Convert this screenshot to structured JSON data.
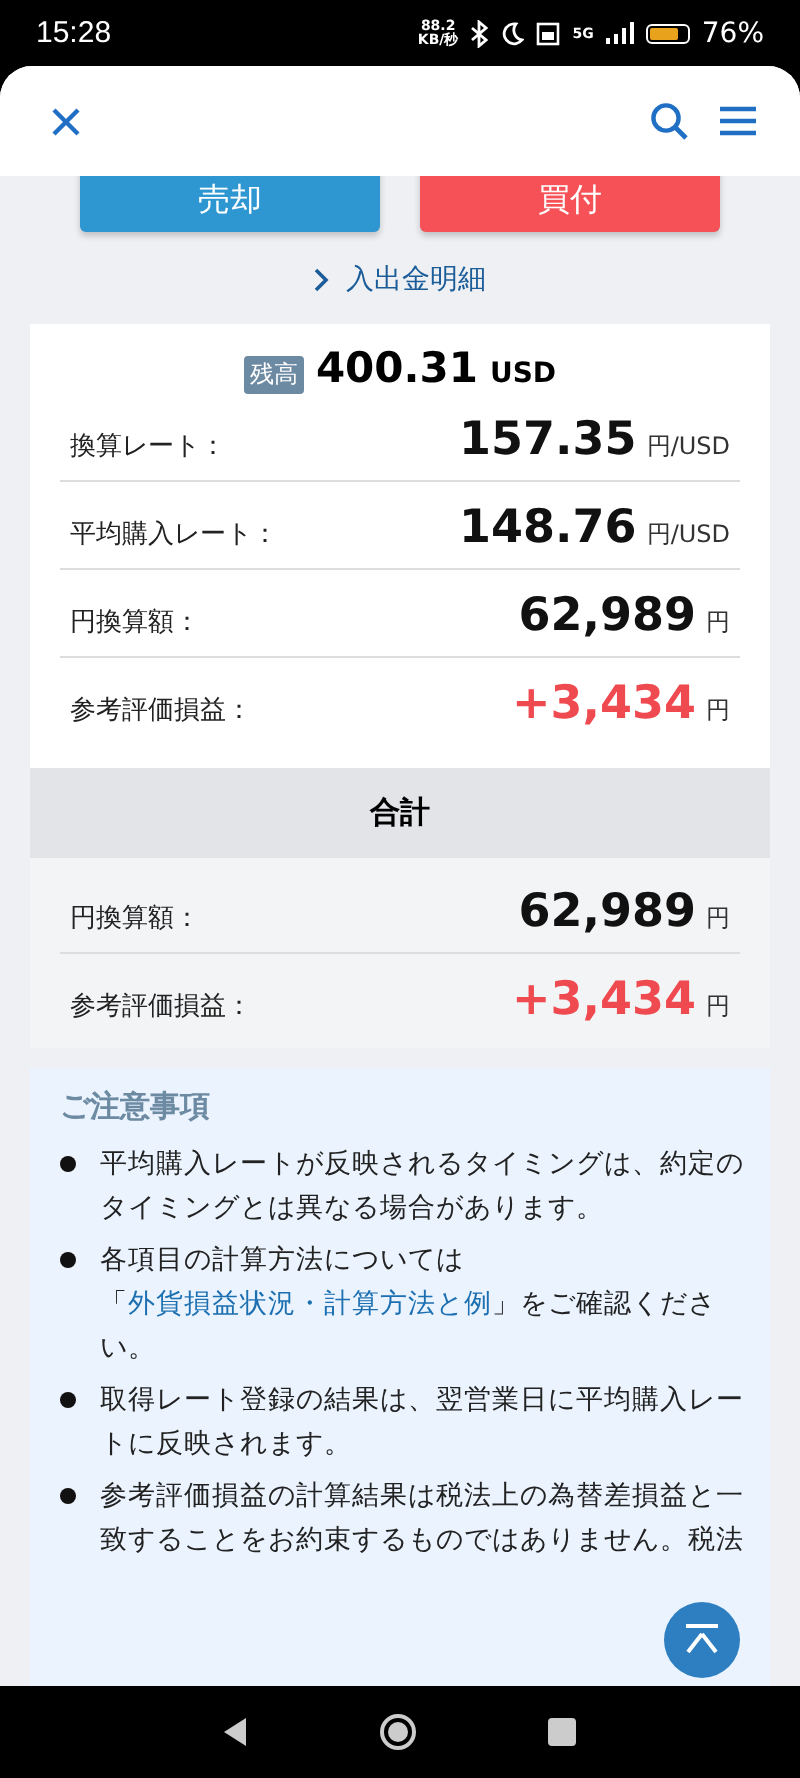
{
  "status_bar": {
    "time": "15:28",
    "speed_value": "88.2",
    "speed_unit": "KB/秒",
    "network": "5G",
    "battery": "76%"
  },
  "actions": [
    {
      "label": "売却",
      "kind": "sell"
    },
    {
      "label": "買付",
      "kind": "buy"
    }
  ],
  "history_link": "入出金明細",
  "balance": {
    "badge": "残高",
    "amount": "400.31",
    "unit": "USD"
  },
  "rows": [
    {
      "label": "換算レート：",
      "value": "157.35",
      "unit": "円/USD",
      "positive": false
    },
    {
      "label": "平均購入レート：",
      "value": "148.76",
      "unit": "円/USD",
      "positive": false
    },
    {
      "label": "円換算額：",
      "value": "62,989",
      "unit": "円",
      "positive": false
    },
    {
      "label": "参考評価損益：",
      "value": "+3,434",
      "unit": "円",
      "positive": true
    }
  ],
  "total": {
    "title": "合計",
    "rows": [
      {
        "label": "円換算額：",
        "value": "62,989",
        "unit": "円",
        "positive": false
      },
      {
        "label": "参考評価損益：",
        "value": "+3,434",
        "unit": "円",
        "positive": true
      }
    ]
  },
  "notes": {
    "title": "ご注意事項",
    "items": [
      {
        "text": "平均購入レートが反映されるタイミングは、約定のタイミングとは異なる場合があります。"
      },
      {
        "before": "各項目の計算方法については「",
        "link": "外貨損益状況・計算方法と例",
        "after": "」をご確認ください。"
      },
      {
        "text": "取得レート登録の結果は、翌営業日に平均購入レートに反映されます。"
      },
      {
        "text": "参考評価損益の計算結果は税法上の為替差損益と一致することをお約束するものではありません。税法"
      }
    ]
  }
}
